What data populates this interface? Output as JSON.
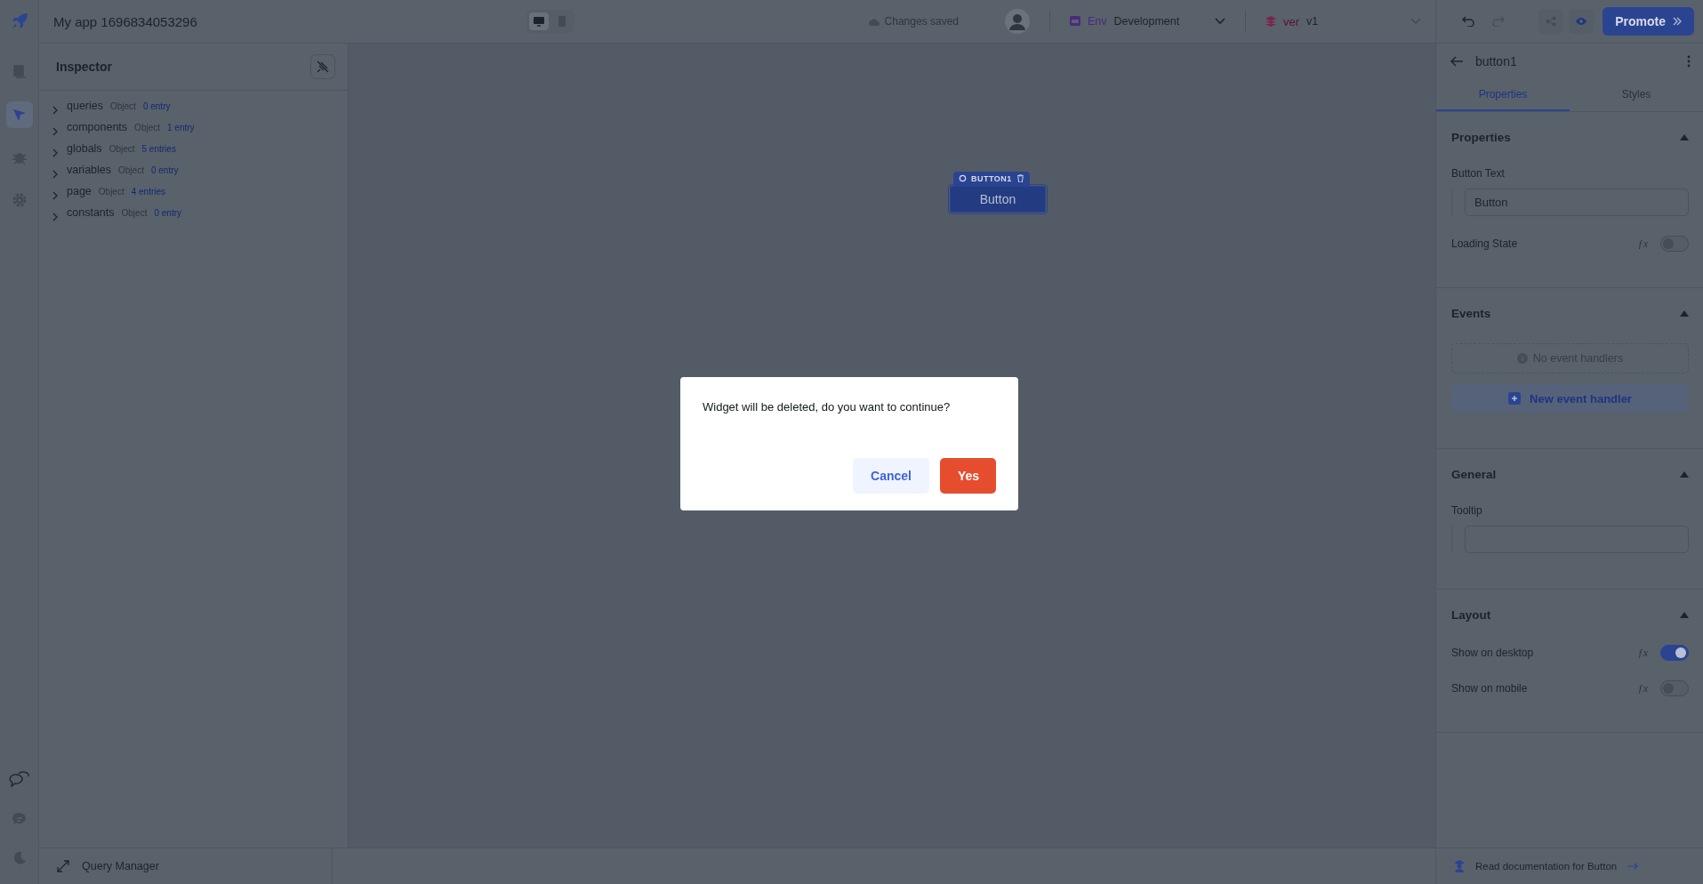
{
  "app_title": "My app 1696834053296",
  "device_toggle": [
    {
      "kind": "desktop",
      "selected": true
    },
    {
      "kind": "mobile",
      "selected": false
    }
  ],
  "save_status": "Changes saved",
  "environment": {
    "label": "Env",
    "value": "Development"
  },
  "version": {
    "label": "ver",
    "value": "v1"
  },
  "promote_button": "Promote",
  "sidebar": {
    "items": [
      {
        "kind": "pages",
        "selected": false
      },
      {
        "kind": "inspector",
        "selected": true
      },
      {
        "kind": "debugger",
        "selected": false
      },
      {
        "kind": "settings",
        "selected": false
      }
    ],
    "bottom_items": [
      {
        "kind": "comments"
      },
      {
        "kind": "chat"
      },
      {
        "kind": "theme"
      }
    ]
  },
  "inspector": {
    "title": "Inspector",
    "nodes": [
      {
        "name": "queries",
        "type": "Object",
        "count": "0 entry",
        "expanded": false
      },
      {
        "name": "components",
        "type": "Object",
        "count": "1 entry",
        "expanded": false
      },
      {
        "name": "globals",
        "type": "Object",
        "count": "5 entries",
        "expanded": false
      },
      {
        "name": "variables",
        "type": "Object",
        "count": "0 entry",
        "expanded": false
      },
      {
        "name": "page",
        "type": "Object",
        "count": "4 entries",
        "expanded": false
      },
      {
        "name": "constants",
        "type": "Object",
        "count": "0 entry",
        "expanded": false
      }
    ]
  },
  "canvas": {
    "widget": {
      "tag": "BUTTON1",
      "label": "Button",
      "selected": true
    }
  },
  "query_manager": "Query Manager",
  "properties_panel": {
    "component": "button1",
    "tabs": [
      {
        "label": "Properties",
        "selected": true
      },
      {
        "label": "Styles",
        "selected": false
      }
    ],
    "sections": [
      {
        "title": "Properties",
        "expanded": true,
        "fields": [
          {
            "kind": "text",
            "label": "Button Text",
            "value": "Button"
          },
          {
            "kind": "toggle",
            "label": "Loading State",
            "formula": "ƒx",
            "on": false
          }
        ]
      },
      {
        "title": "Events",
        "expanded": true,
        "fields": [
          {
            "kind": "empty",
            "label": "No event handlers"
          },
          {
            "kind": "add",
            "label": "New event handler"
          }
        ]
      },
      {
        "title": "General",
        "expanded": true,
        "fields": [
          {
            "kind": "text",
            "label": "Tooltip"
          }
        ]
      },
      {
        "title": "Layout",
        "expanded": true,
        "fields": [
          {
            "kind": "toggle",
            "label": "Show on desktop",
            "formula": "ƒx",
            "on": true
          },
          {
            "kind": "toggle",
            "label": "Show on mobile",
            "formula": "ƒx",
            "on": false
          }
        ]
      }
    ]
  },
  "docs_link": "Read documentation for Button",
  "dialog": {
    "message": "Widget will be deleted, do you want to continue?",
    "buttons": [
      {
        "kind": "secondary",
        "label": "Cancel"
      },
      {
        "kind": "danger",
        "label": "Yes"
      }
    ]
  }
}
